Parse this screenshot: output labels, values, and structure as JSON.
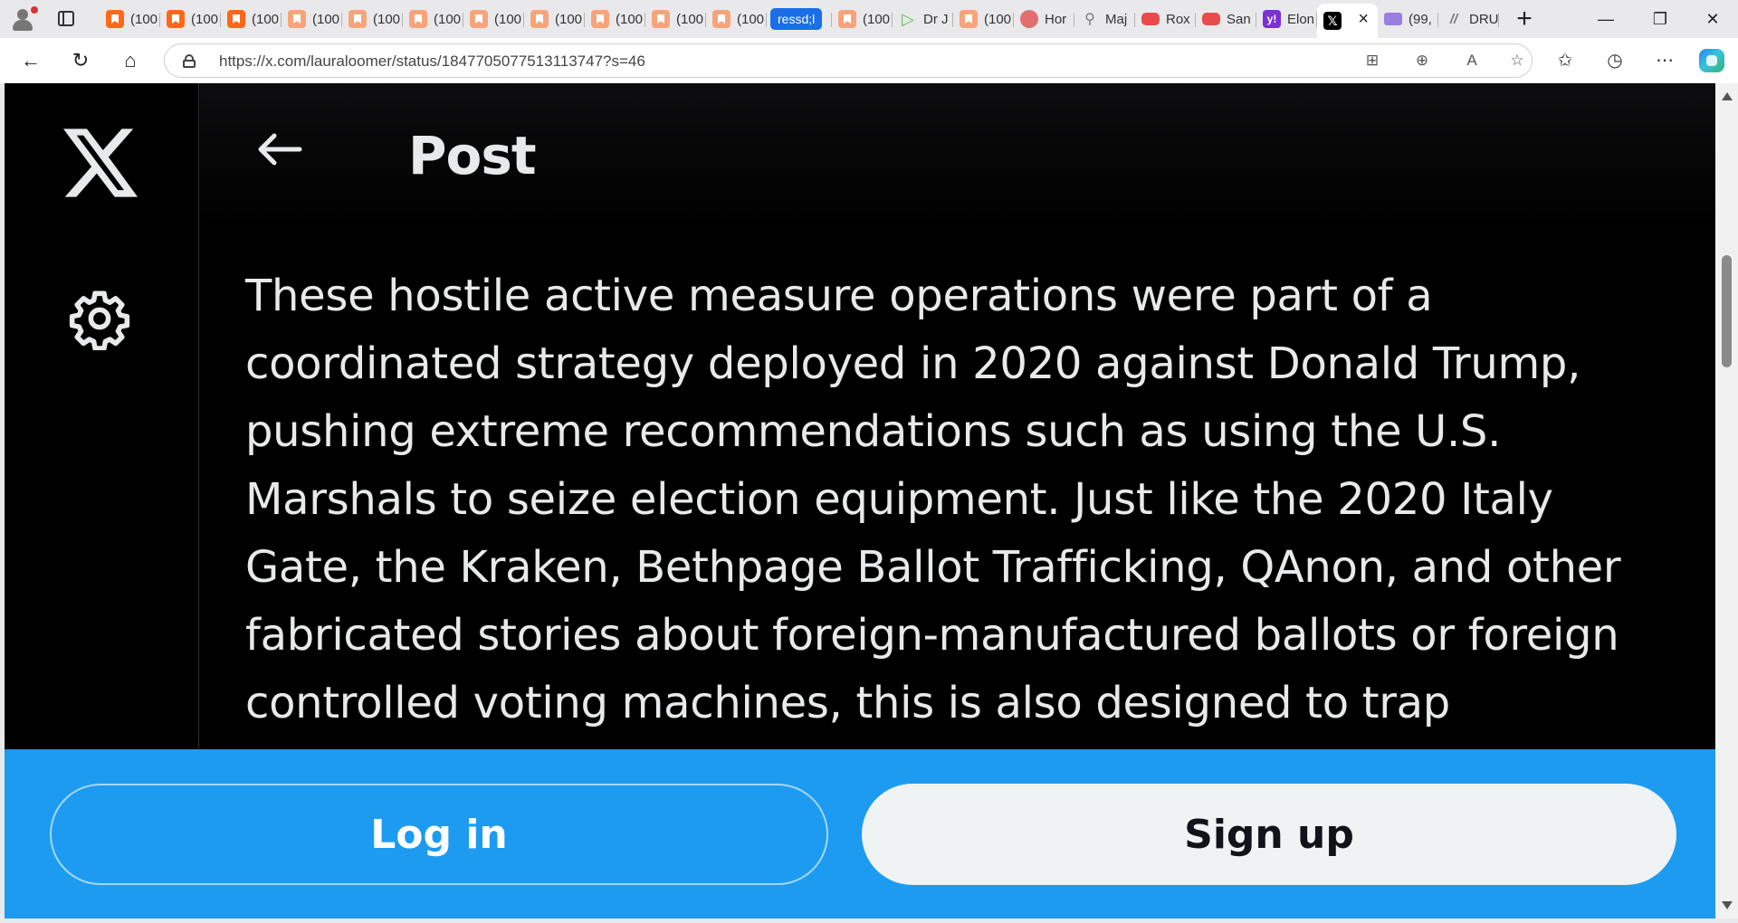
{
  "browser": {
    "tabs": [
      {
        "icon": "substack-icon",
        "label": "(100"
      },
      {
        "icon": "substack-icon",
        "label": "(100"
      },
      {
        "icon": "substack-icon",
        "label": "(100"
      },
      {
        "icon": "substack-icon",
        "label": "(100"
      },
      {
        "icon": "substack-icon",
        "label": "(100"
      },
      {
        "icon": "substack-icon",
        "label": "(100"
      },
      {
        "icon": "substack-icon",
        "label": "(100"
      },
      {
        "icon": "substack-icon",
        "label": "(100"
      },
      {
        "icon": "substack-icon",
        "label": "(100"
      },
      {
        "icon": "substack-icon",
        "label": "(100"
      },
      {
        "icon": "substack-icon",
        "label": "(100"
      },
      {
        "icon": "pill",
        "label": "ressd;l"
      },
      {
        "icon": "substack-icon",
        "label": "(100"
      },
      {
        "icon": "play-icon",
        "label": "Dr J"
      },
      {
        "icon": "substack-icon",
        "label": "(100"
      },
      {
        "icon": "podcast-icon",
        "label": "Hor"
      },
      {
        "icon": "search-icon",
        "label": "Maj"
      },
      {
        "icon": "youtube-icon",
        "label": "Rox"
      },
      {
        "icon": "youtube-icon",
        "label": "San"
      },
      {
        "icon": "yahoo-icon",
        "label": "Elon"
      },
      {
        "icon": "x-icon",
        "label": ""
      },
      {
        "icon": "mail-icon",
        "label": "(99,"
      },
      {
        "icon": "dru-icon",
        "label": "DRU"
      }
    ],
    "url": "https://x.com/lauraloomer/status/1847705077513113747?s=46"
  },
  "page": {
    "title": "Post",
    "post_text": "These hostile active measure operations were part of a\ncoordinated strategy deployed in 2020 against Donald Trump,\npushing extreme recommendations such as using the U.S.\nMarshals to seize election equipment. Just like the 2020 Italy\nGate, the Kraken, Bethpage Ballot Trafficking, QAnon, and other\nfabricated stories about foreign-manufactured ballots or foreign\ncontrolled  voting machines, this is also designed to trap",
    "login_label": "Log in",
    "signup_label": "Sign up"
  },
  "colors": {
    "accent": "#1d9bf0",
    "page_bg": "#000000",
    "text": "#e7e9ea"
  }
}
